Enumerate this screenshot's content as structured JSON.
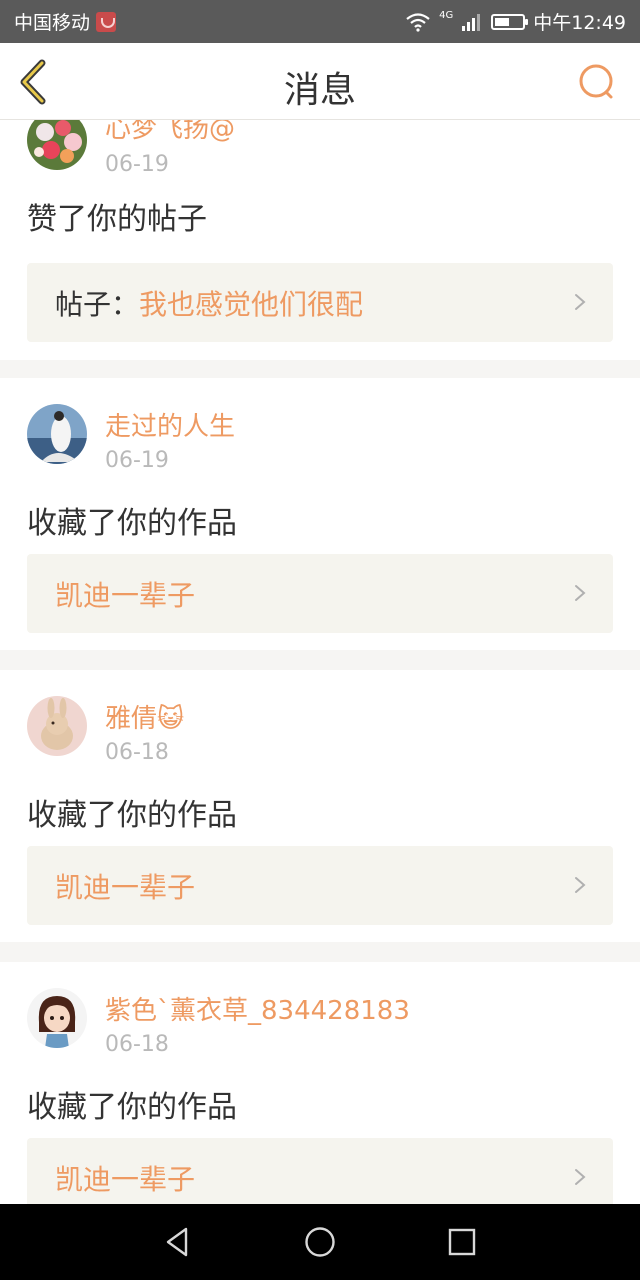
{
  "status_bar": {
    "carrier": "中国移动",
    "net_tag": "4G",
    "battery_level": 0.55,
    "time": "中午12:49"
  },
  "header": {
    "title": "消息"
  },
  "colors": {
    "accent": "#ee9a62",
    "text": "#333333",
    "muted": "#b9b9b9",
    "card_bg": "#f5f4ee"
  },
  "messages": [
    {
      "user": "心梦飞扬@",
      "date": "06-19",
      "action": "赞了你的帖子",
      "card_prefix": "帖子：",
      "card_title": "我也感觉他们很配"
    },
    {
      "user": "走过的人生",
      "date": "06-19",
      "action": "收藏了你的作品",
      "card_prefix": "",
      "card_title": "凯迪一辈子"
    },
    {
      "user": "雅倩",
      "user_emoji": "😺",
      "date": "06-18",
      "action": "收藏了你的作品",
      "card_prefix": "",
      "card_title": "凯迪一辈子"
    },
    {
      "user": "紫色`薰衣草_834428183",
      "date": "06-18",
      "action": "收藏了你的作品",
      "card_prefix": "",
      "card_title": "凯迪一辈子"
    }
  ]
}
